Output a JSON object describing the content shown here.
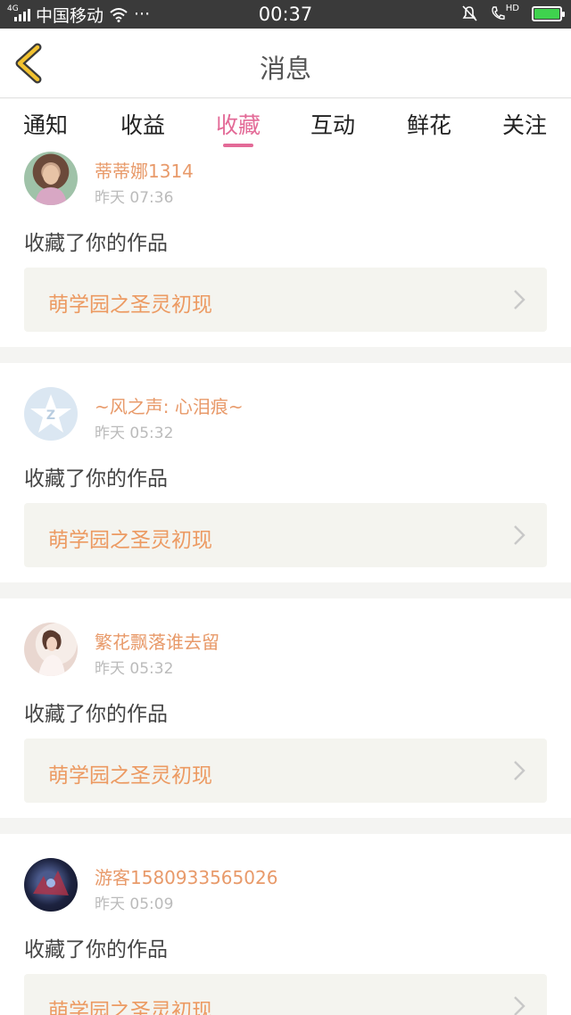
{
  "status_bar": {
    "network": "4G",
    "carrier": "中国移动",
    "more": "···",
    "time": "00:37",
    "hd": "HD"
  },
  "nav": {
    "title": "消息"
  },
  "tabs": [
    {
      "label": "通知"
    },
    {
      "label": "收益"
    },
    {
      "label": "收藏",
      "active": true
    },
    {
      "label": "互动"
    },
    {
      "label": "鲜花"
    },
    {
      "label": "关注"
    }
  ],
  "items": [
    {
      "username": "蒂蒂娜1314",
      "time": "昨天 07:36",
      "action": "收藏了你的作品",
      "work": "萌学园之圣灵初现",
      "avatar": "photo-avatar"
    },
    {
      "username": "~风之声: 心泪痕~",
      "time": "昨天 05:32",
      "action": "收藏了你的作品",
      "work": "萌学园之圣灵初现",
      "avatar": "default-star-avatar"
    },
    {
      "username": "繁花飘落谁去留",
      "time": "昨天 05:32",
      "action": "收藏了你的作品",
      "work": "萌学园之圣灵初现",
      "avatar": "photo-avatar"
    },
    {
      "username": "游客1580933565026",
      "time": "昨天 05:09",
      "action": "收藏了你的作品",
      "work": "萌学园之圣灵初现",
      "avatar": "photo-avatar"
    }
  ],
  "colors": {
    "accent_pink": "#e36a97",
    "username_orange": "#e89a6a",
    "work_title_orange": "#ec9a62",
    "work_box_bg": "#f4f4ef",
    "back_arrow_yellow": "#f2c230"
  }
}
